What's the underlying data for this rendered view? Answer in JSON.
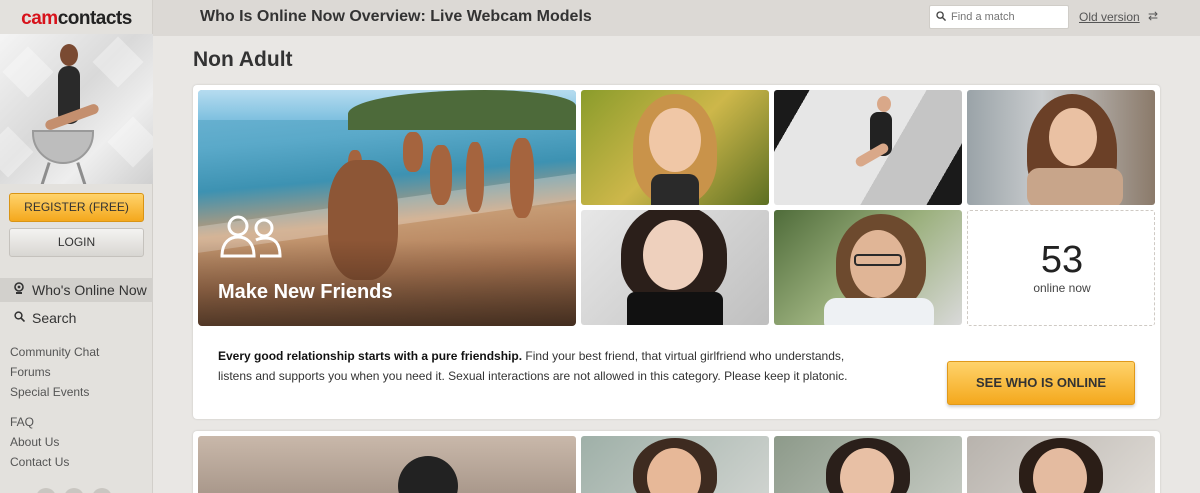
{
  "brand": {
    "logo_part1": "cam",
    "logo_part2": "contacts"
  },
  "sidebar": {
    "register_label": "REGISTER (FREE)",
    "login_label": "LOGIN",
    "nav": [
      {
        "label": "Who's Online Now",
        "icon": "webcam-icon"
      },
      {
        "label": "Search",
        "icon": "search-icon"
      }
    ],
    "links_group1": [
      "Community Chat",
      "Forums",
      "Special Events"
    ],
    "links_group2": [
      "FAQ",
      "About Us",
      "Contact Us"
    ]
  },
  "header": {
    "title": "Who Is Online Now Overview: Live Webcam Models",
    "search_placeholder": "Find a match",
    "old_version_label": "Old version",
    "swap_icon": "⇄"
  },
  "section": {
    "title": "Non Adult",
    "feature_label": "Make New Friends",
    "online_count": "53",
    "online_label": "online now",
    "description_bold": "Every good relationship starts with a pure friendship.",
    "description_rest": " Find your best friend, that virtual girlfriend who understands, listens and supports you when you need it. Sexual interactions are not allowed in this category. Please keep it platonic.",
    "cta_label": "SEE WHO IS ONLINE"
  },
  "colors": {
    "brand_red": "#d7121b",
    "accent_orange": "#f4a81d",
    "sidebar_bg": "#e3e1dd"
  }
}
